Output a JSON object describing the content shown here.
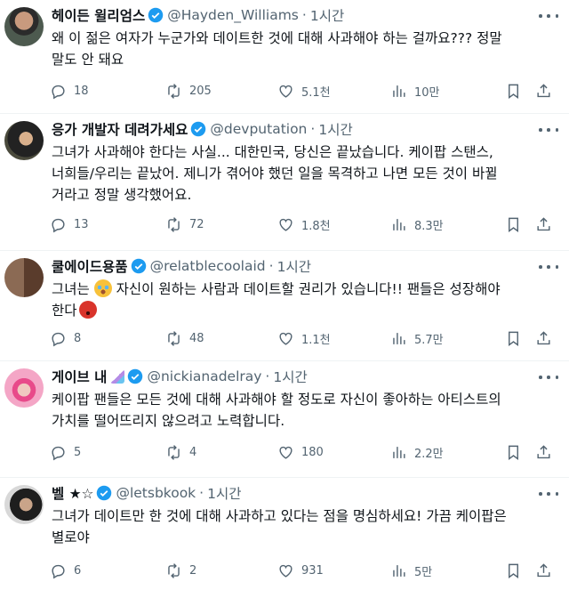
{
  "tweets": [
    {
      "name": "헤이든 윌리엄스",
      "handle": "@Hayden_Williams",
      "time": "1시간",
      "text": "왜 이 젊은 여자가 누군가와 데이트한 것에 대해 사과해야 하는 걸까요??? 정말\n말도 안 돼요",
      "replies": "18",
      "retweets": "205",
      "likes": "5.1천",
      "views": "10만"
    },
    {
      "name": "응가 개발자 데려가세요",
      "handle": "@devputation",
      "time": "1시간",
      "text": "그녀가 사과해야 한다는 사실... 대한민국, 당신은 끝났습니다. 케이팝 스탠스,\n너희들/우리는 끝났어. 제니가 겪어야 했던 일을 목격하고 나면 모든 것이 바뀔\n거라고 정말 생각했어요.",
      "replies": "13",
      "retweets": "72",
      "likes": "1.8천",
      "views": "8.3만"
    },
    {
      "name": "쿨에이드용품",
      "handle": "@relatblecoolaid",
      "time": "1시간",
      "text_a": "그녀는 ",
      "text_b": " 자신이 원하는 사람과 데이트할 권리가 있습니다!! 팬들은 성장해야",
      "text_c": "\n한다",
      "replies": "8",
      "retweets": "48",
      "likes": "1.1천",
      "views": "5.7만"
    },
    {
      "name": "게이브 내",
      "handle": "@nickianadelray",
      "time": "1시간",
      "text": "케이팝 팬들은 모든 것에 대해 사과해야 할 정도로 자신이 좋아하는 아티스트의\n가치를 떨어뜨리지 않으려고 노력합니다.",
      "replies": "5",
      "retweets": "4",
      "likes": "180",
      "views": "2.2만"
    },
    {
      "name": "벨 ★☆",
      "handle": "@letsbkook",
      "time": "1시간",
      "text": "그녀가 데이트만 한 것에 대해 사과하고 있다는 점을 명심하세요! 가끔 케이팝은\n별로야",
      "replies": "6",
      "retweets": "2",
      "likes": "931",
      "views": "5만"
    }
  ],
  "colors": {
    "verified": "#1d9bf0",
    "secondary": "#536471",
    "text": "#0f1419",
    "divider": "#eff3f4"
  },
  "icons": [
    "reply-icon",
    "retweet-icon",
    "like-icon",
    "views-icon",
    "bookmark-icon",
    "share-icon",
    "more-icon",
    "verified-badge-icon",
    "crying-face-emoji",
    "angry-face-emoji",
    "unicorn-emoji"
  ]
}
